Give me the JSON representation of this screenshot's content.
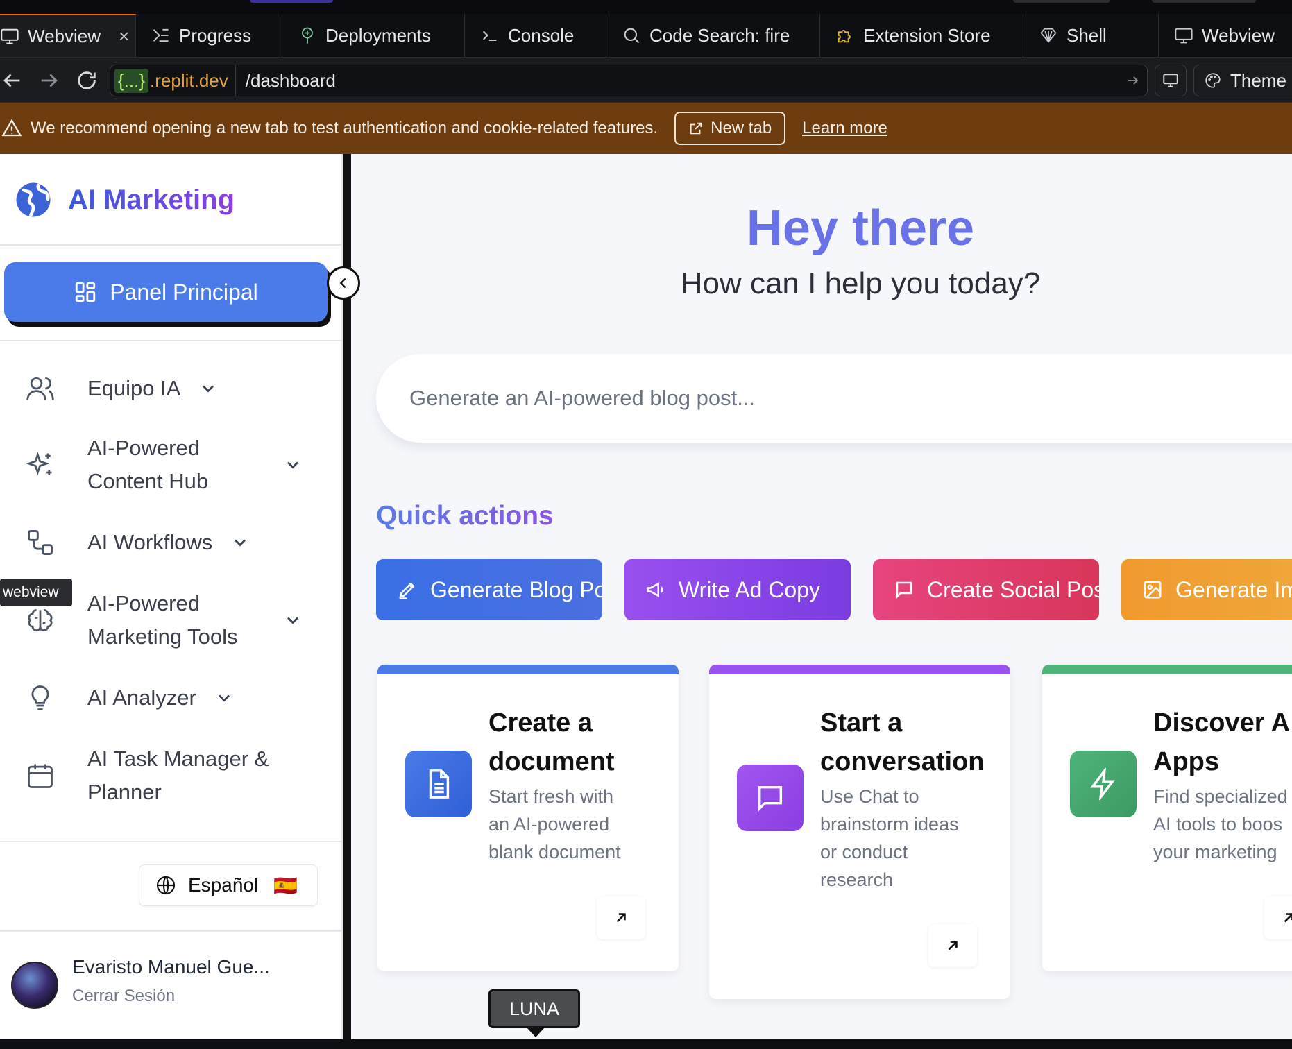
{
  "ide": {
    "tabs": [
      {
        "label": "Webview",
        "icon": "monitor-icon",
        "active": true
      },
      {
        "label": "Progress",
        "icon": "progress-icon"
      },
      {
        "label": "Deployments",
        "icon": "deployments-icon"
      },
      {
        "label": "Console",
        "icon": "terminal-icon"
      },
      {
        "label": "Code Search: fire",
        "icon": "search-icon"
      },
      {
        "label": "Extension Store",
        "icon": "puzzle-icon"
      },
      {
        "label": "Shell",
        "icon": "shell-icon"
      },
      {
        "label": "Webview",
        "icon": "monitor-icon"
      }
    ],
    "tab_close": "×",
    "url_host_prefix": "{...}",
    "url_host": ".replit.dev",
    "url_path": "/dashboard",
    "theme_label": "Theme",
    "banner_text": "We recommend opening a new tab to test authentication and cookie-related features.",
    "banner_newtab": "New tab",
    "banner_learn": "Learn more",
    "tooltip_webview": "webview"
  },
  "app": {
    "brand": "AI Marketing",
    "panel_button": "Panel Principal",
    "nav": [
      {
        "label": "Equipo IA",
        "icon": "users-icon"
      },
      {
        "label_line1": "AI-Powered",
        "label_line2": "Content Hub",
        "icon": "sparkles-icon"
      },
      {
        "label": "AI Workflows",
        "icon": "workflow-icon"
      },
      {
        "label_line1": "AI-Powered",
        "label_line2": "Marketing Tools",
        "icon": "brain-icon"
      },
      {
        "label": "AI Analyzer",
        "icon": "lightbulb-icon"
      },
      {
        "label_line1": "AI Task Manager &",
        "label_line2": "Planner",
        "icon": "calendar-icon"
      }
    ],
    "language": "Español",
    "language_flag": "🇪🇸",
    "user_name": "Evaristo Manuel Gue...",
    "logout": "Cerrar Sesión",
    "hero_title": "Hey there",
    "hero_subtitle": "How can I help you today?",
    "search_placeholder": "Generate an AI-powered blog post...",
    "quick_actions_title": "Quick actions",
    "quick_actions": [
      {
        "label": "Generate Blog Post",
        "icon": "pencil-icon",
        "color": "#3a6fe6"
      },
      {
        "label": "Write Ad Copy",
        "icon": "megaphone-icon",
        "color": "#8b45ea"
      },
      {
        "label": "Create Social Post",
        "icon": "message-icon",
        "color": "#df3a6e"
      },
      {
        "label": "Generate Im",
        "icon": "image-icon",
        "color": "#ee9a2e"
      }
    ],
    "cards": [
      {
        "title_line1": "Create a",
        "title_line2": "document",
        "desc": [
          "Start fresh with",
          "an AI-powered",
          "blank document"
        ],
        "icon": "document-icon",
        "color": "#3a6fe6"
      },
      {
        "title_line1": "Start a",
        "title_line2": "conversation",
        "desc": [
          "Use Chat to",
          "brainstorm ideas",
          "or conduct",
          "research"
        ],
        "icon": "chat-icon",
        "color": "#9346ea"
      },
      {
        "title_line1": "Discover A",
        "title_line2": "Apps",
        "desc": [
          "Find specialized",
          "AI tools to boos",
          "your marketing"
        ],
        "icon": "bolt-icon",
        "color": "#3fa66a"
      }
    ],
    "luna_label": "LUNA"
  }
}
